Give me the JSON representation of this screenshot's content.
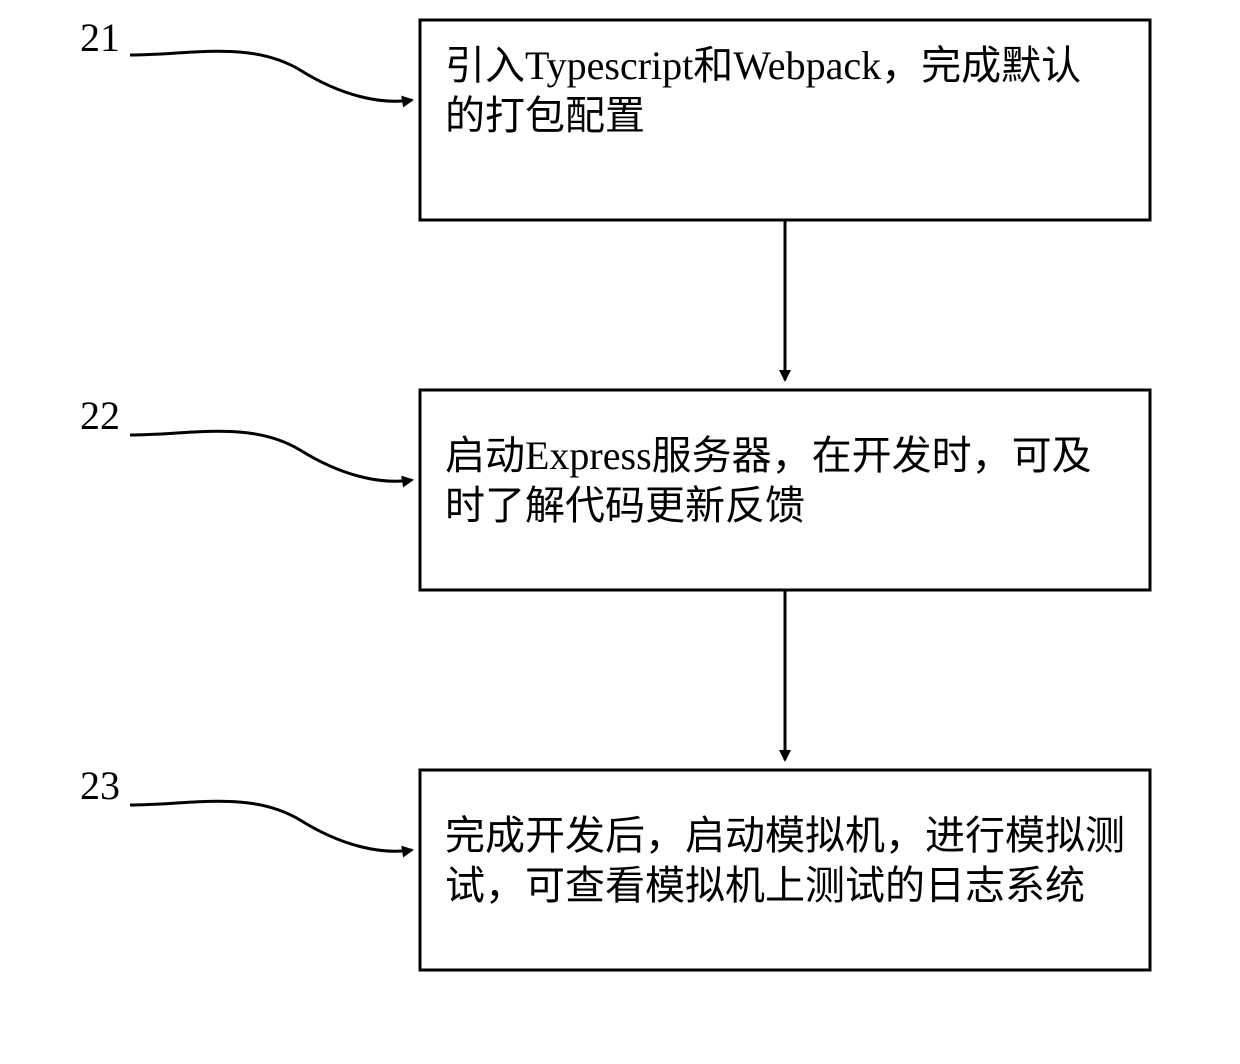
{
  "diagram": {
    "steps": [
      {
        "id": "21",
        "line1": "引入Typescript和Webpack，完成默认",
        "line2": "的打包配置"
      },
      {
        "id": "22",
        "line1": "启动Express服务器，在开发时，可及",
        "line2": "时了解代码更新反馈"
      },
      {
        "id": "23",
        "line1": "完成开发后，启动模拟机，进行模拟测",
        "line2": "试，可查看模拟机上测试的日志系统"
      }
    ]
  }
}
